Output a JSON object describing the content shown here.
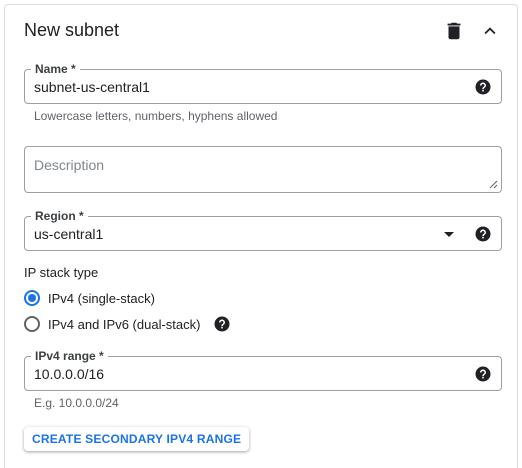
{
  "header": {
    "title": "New subnet",
    "delete_icon": "trash-icon",
    "collapse_icon": "chevron-up-icon"
  },
  "name_field": {
    "label": "Name *",
    "value": "subnet-us-central1",
    "hint": "Lowercase letters, numbers, hyphens allowed"
  },
  "description_field": {
    "placeholder": "Description"
  },
  "region_field": {
    "label": "Region *",
    "value": "us-central1"
  },
  "ip_stack": {
    "label": "IP stack type",
    "options": [
      {
        "label": "IPv4 (single-stack)",
        "checked": true
      },
      {
        "label": "IPv4 and IPv6 (dual-stack)",
        "checked": false
      }
    ]
  },
  "ipv4_range_field": {
    "label": "IPv4 range *",
    "value": "10.0.0.0/16",
    "hint": "E.g. 10.0.0.0/24"
  },
  "secondary_range_button": {
    "label": "CREATE SECONDARY IPV4 RANGE"
  },
  "colors": {
    "accent": "#1a73e8",
    "border": "#9aa0a6",
    "text": "#202124",
    "muted": "#5f6368"
  }
}
